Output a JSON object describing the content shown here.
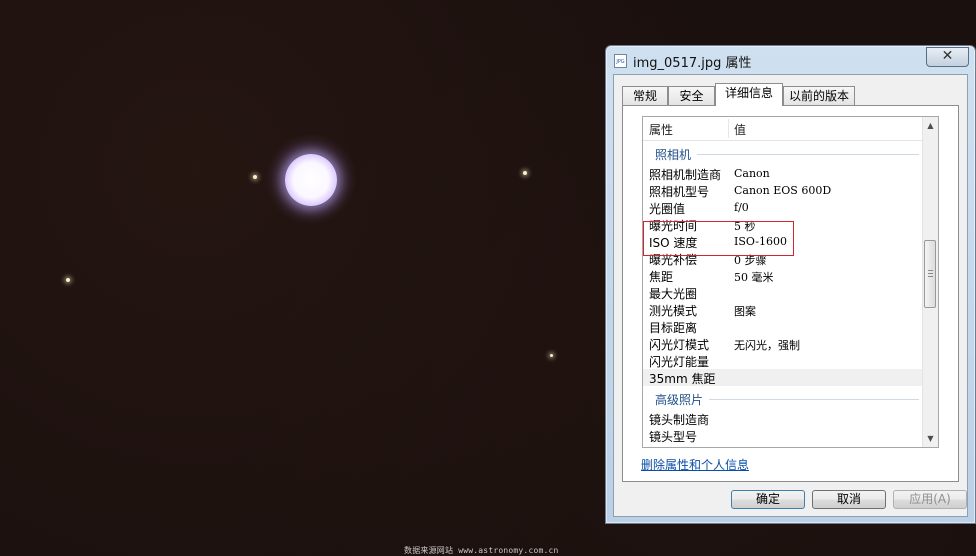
{
  "window": {
    "title": "img_0517.jpg 属性",
    "close_glyph": "✕"
  },
  "tabs": [
    {
      "label": "常规"
    },
    {
      "label": "安全"
    },
    {
      "label": "详细信息"
    },
    {
      "label": "以前的版本"
    }
  ],
  "list": {
    "header": {
      "property": "属性",
      "value": "值"
    },
    "camera_group": "照相机",
    "camera_rows": [
      {
        "key": "照相机制造商",
        "value": "Canon"
      },
      {
        "key": "照相机型号",
        "value": "Canon EOS 600D"
      },
      {
        "key": "光圈值",
        "value": "f/0"
      },
      {
        "key": "曝光时间",
        "value": "5 秒"
      },
      {
        "key": "ISO 速度",
        "value": "ISO-1600"
      },
      {
        "key": "曝光补偿",
        "value": "0 步骤"
      },
      {
        "key": "焦距",
        "value": "50 毫米"
      },
      {
        "key": "最大光圈",
        "value": ""
      },
      {
        "key": "测光模式",
        "value": "图案"
      },
      {
        "key": "目标距离",
        "value": ""
      },
      {
        "key": "闪光灯模式",
        "value": "无闪光，强制"
      },
      {
        "key": "闪光灯能量",
        "value": ""
      },
      {
        "key": "35mm 焦距",
        "value": ""
      }
    ],
    "advanced_group": "高级照片",
    "advanced_rows": [
      {
        "key": "镜头制造商",
        "value": ""
      },
      {
        "key": "镜头型号",
        "value": ""
      }
    ]
  },
  "scroll": {
    "up_glyph": "▲",
    "down_glyph": "▼"
  },
  "remove_link": "删除属性和个人信息",
  "buttons": {
    "ok": "确定",
    "cancel": "取消",
    "apply": "应用(A)"
  },
  "watermark": "数据来源网站 www.astronomy.com.cn",
  "colors": {
    "highlight_box": "#d0262d",
    "link": "#0a4ea8",
    "group_heading": "#1f4f8a"
  },
  "icons": {
    "title": "jpg-file-icon",
    "close": "close-icon",
    "scroll_up": "scroll-up-arrow-icon",
    "scroll_down": "scroll-down-arrow-icon"
  }
}
